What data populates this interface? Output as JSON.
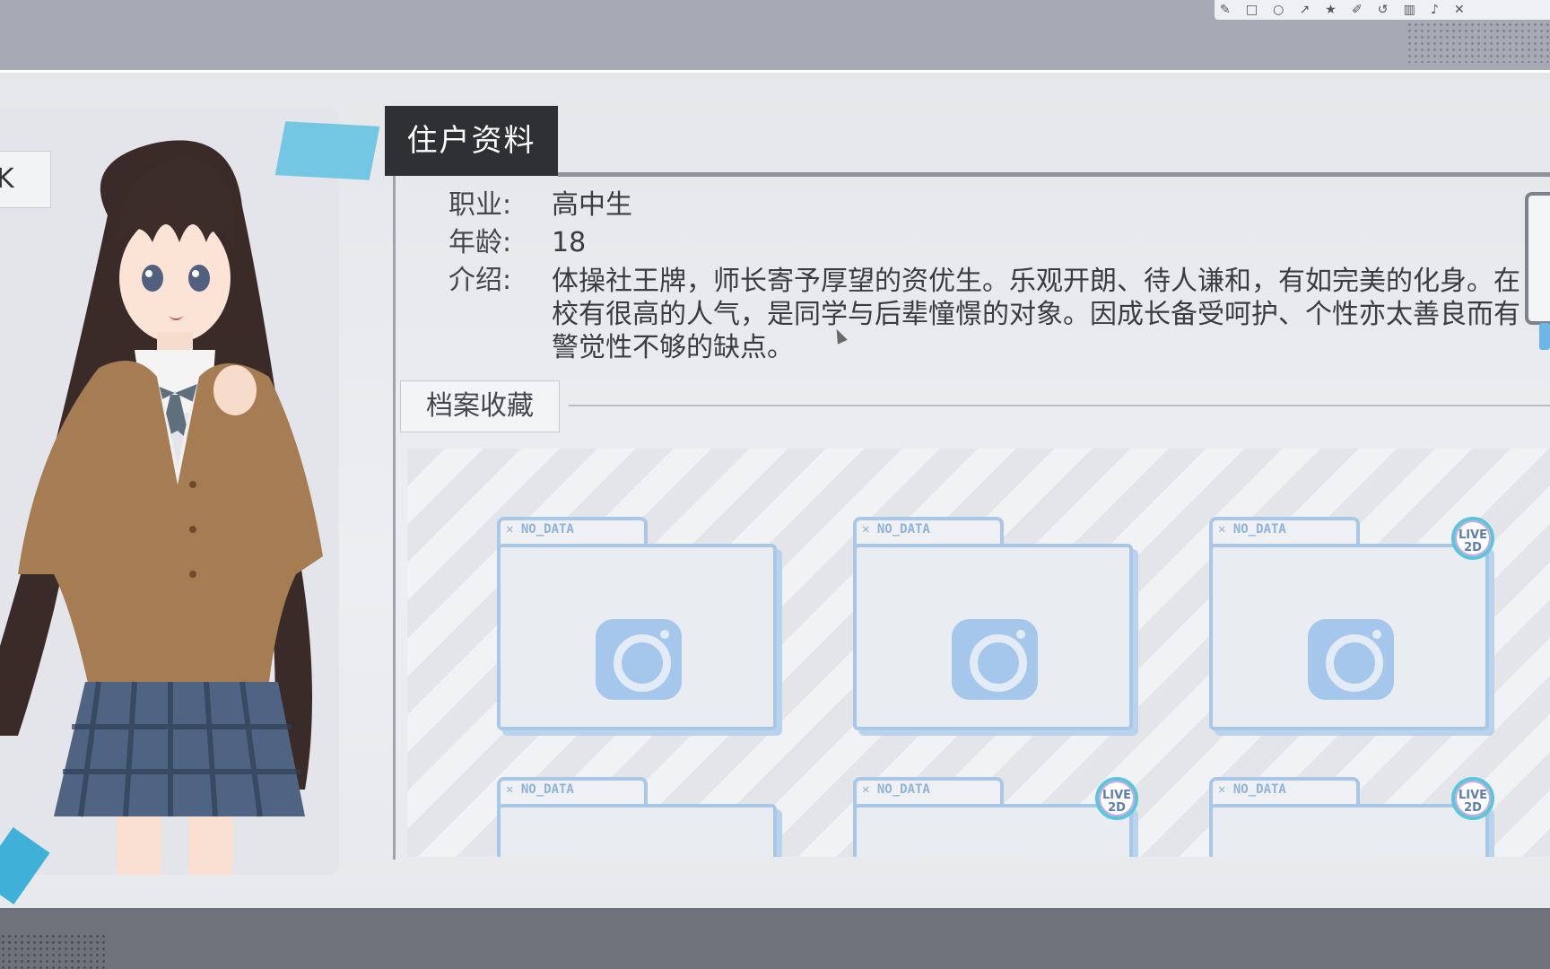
{
  "toolbar": {
    "icons": [
      "pen-icon",
      "square-icon",
      "circle-icon",
      "arrow-icon",
      "pin-icon",
      "marker-icon",
      "undo-icon",
      "trash-icon",
      "speaker-icon",
      "eye-off-icon",
      "close-icon"
    ]
  },
  "side_tab": {
    "label": "K"
  },
  "section": {
    "title": "住户资料"
  },
  "profile": {
    "occupation_label": "职业:",
    "occupation": "高中生",
    "age_label": "年龄:",
    "age": "18",
    "intro_label": "介绍:",
    "intro": "体操社王牌，师长寄予厚望的资优生。乐观开朗、待人谦和，有如完美的化身。在校有很高的人气，是同学与后辈憧憬的对象。因成长备受呵护、个性亦太善良而有警觉性不够的缺点。"
  },
  "archive": {
    "tab_label": "档案收藏",
    "folders": [
      {
        "label": "NO_DATA",
        "badge": ""
      },
      {
        "label": "NO_DATA",
        "badge": ""
      },
      {
        "label": "NO_DATA",
        "badge": "LIVE 2D"
      },
      {
        "label": "NO_DATA",
        "badge": ""
      },
      {
        "label": "NO_DATA",
        "badge": "LIVE 2D"
      },
      {
        "label": "NO_DATA",
        "badge": "LIVE 2D"
      }
    ],
    "folder_icon": "camera-icon",
    "folder_close_icon": "x-icon"
  },
  "colors": {
    "accent_blue": "#74c7e3",
    "folder_blue": "#a9c8e8",
    "title_bg": "#2f3034"
  }
}
